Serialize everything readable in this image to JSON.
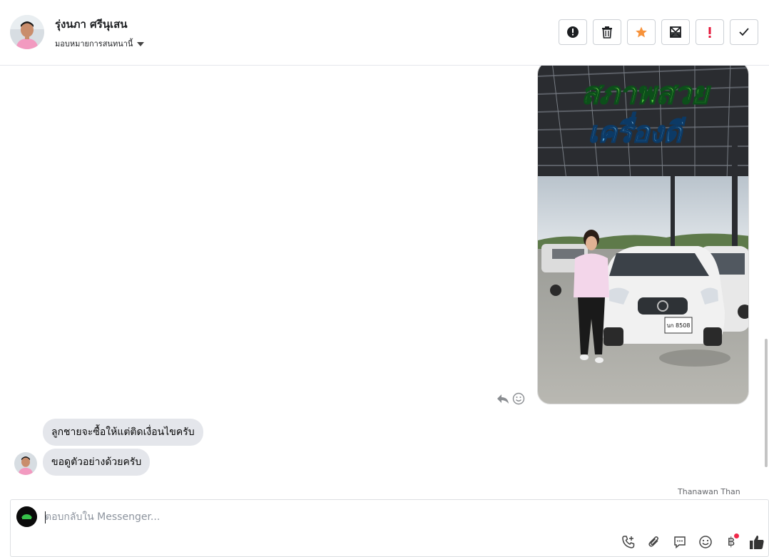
{
  "header": {
    "contact_name": "รุ่งนภา ศรีนุเสน",
    "assign_label": "มอบหมายการสนทนานี้",
    "actions": [
      {
        "name": "mark-spam-button",
        "icon": "alert-circle-icon"
      },
      {
        "name": "delete-button",
        "icon": "trash-icon"
      },
      {
        "name": "star-button",
        "icon": "star-icon"
      },
      {
        "name": "mark-unread-button",
        "icon": "envelope-open-icon"
      },
      {
        "name": "follow-up-button",
        "icon": "exclamation-icon"
      },
      {
        "name": "mark-done-button",
        "icon": "checkmark-icon"
      }
    ]
  },
  "messages": {
    "photo_caption_line1": "สภาพสวย",
    "photo_caption_line2": "เครื่องดี",
    "plate_text": "บก 8508",
    "incoming": [
      {
        "text": "ลูกชายจะซื้อให้แต่ติดเงื่อนไขครับ"
      },
      {
        "text": "ขอดูตัวอย่างด้วยครับ"
      }
    ],
    "seen_by": "Thanawan Than"
  },
  "composer": {
    "placeholder": "ตอบกลับใน Messenger...",
    "value": "",
    "tools": [
      "phone-icon",
      "paperclip-icon",
      "saved-reply-icon",
      "emoji-icon",
      "baht-payment-icon",
      "thumbs-up-icon"
    ],
    "payment_symbol": "฿"
  },
  "colors": {
    "accent_star": "#f7923a",
    "follow_up_red": "#e4163a",
    "notification_dot": "#f02849",
    "bubble_gray": "#e4e6eb"
  }
}
